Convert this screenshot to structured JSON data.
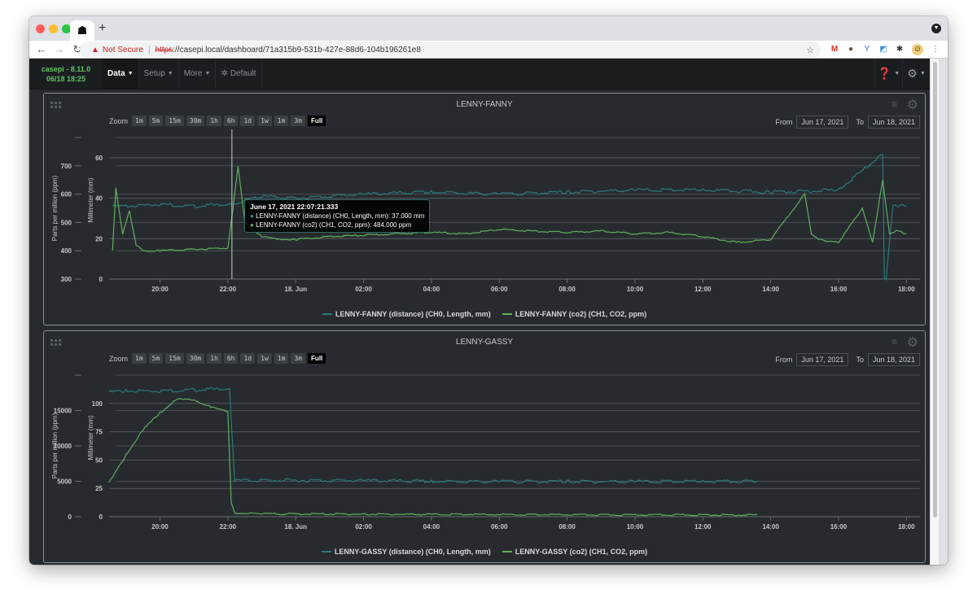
{
  "browser": {
    "tab_icon": "skull-icon",
    "new_tab": "+",
    "security_label": "Not Secure",
    "url_scheme": "https",
    "url_rest": "://casepi.local/dashboard/71a315b9-531b-427e-88d6-104b196261e8"
  },
  "navbar": {
    "brand_line1": "casepi - 8.11.0",
    "brand_line2": "06/18 18:25",
    "items": [
      {
        "label": "Data",
        "active": true
      },
      {
        "label": "Setup",
        "active": false
      },
      {
        "label": "More",
        "active": false
      }
    ],
    "dashboard_label": "Default",
    "brand_color": "#62c462"
  },
  "zoom": {
    "label": "Zoom",
    "buttons": [
      "1m",
      "5m",
      "15m",
      "30m",
      "1h",
      "6h",
      "1d",
      "1w",
      "1m",
      "3m",
      "Full"
    ],
    "selected": "Full"
  },
  "range": {
    "from_label": "From",
    "to_label": "To",
    "from": "Jun 17, 2021",
    "to": "Jun 18, 2021"
  },
  "colors": {
    "distance": "#2a7a78",
    "co2": "#5faf5a"
  },
  "panels": [
    {
      "title": "LENNY-FANNY",
      "tooltip": {
        "time": "June 17, 2021 22:07:21.333",
        "line1": "LENNY-FANNY (distance) (CH0, Length, mm): 37.000 mm",
        "line2": "LENNY-FANNY (co2) (CH1, CO2, ppm): 484.000 ppm"
      },
      "legend": [
        "LENNY-FANNY (distance) (CH0, Length, mm)",
        "LENNY-FANNY (co2) (CH1, CO2, ppm)"
      ]
    },
    {
      "title": "LENNY-GASSY",
      "legend": [
        "LENNY-GASSY (distance) (CH0, Length, mm)",
        "LENNY-GASSY (co2) (CH1, CO2, ppm)"
      ]
    }
  ],
  "chart_data": [
    {
      "type": "line",
      "title": "LENNY-FANNY",
      "xlabel": "",
      "x_ticks": [
        "20:00",
        "22:00",
        "18. Jun",
        "02:00",
        "04:00",
        "06:00",
        "08:00",
        "10:00",
        "12:00",
        "14:00",
        "16:00",
        "18:00"
      ],
      "x_range_hours": [
        18.5,
        18.4
      ],
      "y_left_outer": {
        "label": "Parts per million (ppm)",
        "ticks": [
          300,
          400,
          500,
          600,
          700
        ],
        "range": [
          300,
          800
        ]
      },
      "y_left_inner": {
        "label": "Millimeter (mm)",
        "ticks": [
          0,
          20,
          40,
          60
        ],
        "range": [
          0,
          70
        ]
      },
      "series": [
        {
          "name": "LENNY-FANNY (distance) (CH0, Length, mm)",
          "axis": "mm",
          "x_hours": [
            18.6,
            19,
            20,
            21,
            22,
            22.1,
            23,
            24,
            26,
            28,
            30,
            32,
            34,
            36,
            38,
            40,
            41.3,
            41.35,
            41.4,
            41.6,
            41.9,
            42
          ],
          "values": [
            36,
            36,
            37,
            36,
            37,
            37,
            41,
            40,
            42,
            43,
            42,
            43,
            44,
            44,
            43,
            44,
            62,
            0,
            0,
            36,
            37,
            36
          ]
        },
        {
          "name": "LENNY-FANNY (co2) (CH1, CO2, ppm)",
          "axis": "ppm",
          "x_hours": [
            18.6,
            18.7,
            18.9,
            19.1,
            19.3,
            19.5,
            20,
            21,
            22,
            22.1,
            22.3,
            22.5,
            23,
            23.5,
            24,
            25,
            26,
            27,
            28,
            29,
            30,
            31,
            32,
            33,
            34,
            35,
            36,
            37,
            38,
            39,
            39.2,
            39.4,
            40,
            40.7,
            41,
            41.3,
            41.5,
            41.7,
            42
          ],
          "values": [
            400,
            620,
            460,
            540,
            420,
            400,
            400,
            405,
            410,
            500,
            700,
            500,
            450,
            440,
            440,
            450,
            455,
            460,
            465,
            460,
            475,
            470,
            465,
            470,
            460,
            465,
            450,
            430,
            440,
            600,
            460,
            440,
            430,
            550,
            430,
            650,
            460,
            470,
            460
          ]
        }
      ]
    },
    {
      "type": "line",
      "title": "LENNY-GASSY",
      "xlabel": "",
      "x_ticks": [
        "20:00",
        "22:00",
        "18. Jun",
        "02:00",
        "04:00",
        "06:00",
        "08:00",
        "10:00",
        "12:00",
        "14:00",
        "16:00",
        "18:00"
      ],
      "y_left_outer": {
        "label": "Parts per million (ppm)",
        "ticks": [
          0,
          5000,
          10000,
          15000
        ],
        "range": [
          0,
          20000
        ]
      },
      "y_left_inner": {
        "label": "Millimeter (mm)",
        "ticks": [
          0,
          25,
          50,
          75,
          100
        ],
        "range": [
          0,
          125
        ]
      },
      "series": [
        {
          "name": "LENNY-GASSY (distance) (CH0, Length, mm)",
          "axis": "mm",
          "x_hours": [
            18.5,
            19,
            20,
            21,
            22,
            22.05,
            22.2,
            24,
            26,
            28,
            30,
            32,
            34,
            36,
            37.6
          ],
          "values": [
            110,
            111,
            111,
            112,
            113,
            113,
            32,
            32,
            32,
            31,
            31,
            31,
            31,
            31,
            31
          ]
        },
        {
          "name": "LENNY-GASSY (co2) (CH1, CO2, ppm)",
          "axis": "ppm",
          "x_hours": [
            18.5,
            19,
            19.5,
            20,
            20.5,
            21,
            21.5,
            22,
            22.1,
            22.2,
            23,
            26,
            30,
            34,
            37.6
          ],
          "values": [
            4800,
            8700,
            12300,
            14700,
            16600,
            16500,
            15500,
            14800,
            2000,
            500,
            400,
            350,
            300,
            250,
            250
          ]
        }
      ]
    }
  ]
}
